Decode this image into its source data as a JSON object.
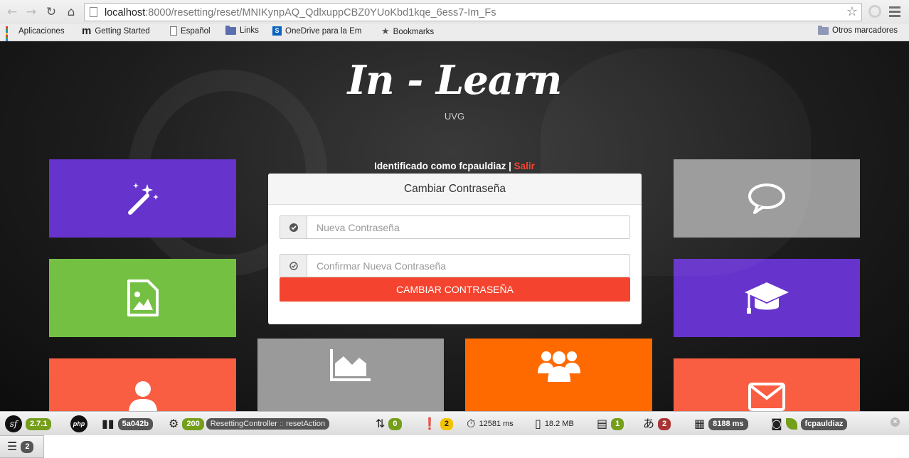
{
  "browser": {
    "url_host": "localhost",
    "url_rest": ":8000/resetting/reset/MNIKynpAQ_QdlxuppCBZ0YUoKbd1kqe_6ess7-Im_Fs",
    "bookmarks": [
      "Aplicaciones",
      "Getting Started",
      "Español",
      "Links",
      "OneDrive para la Em",
      "Bookmarks"
    ],
    "other_bookmarks": "Otros marcadores"
  },
  "site": {
    "title": "In - Learn",
    "subtitle": "UVG",
    "identified_prefix": "Identificado como fcpauldiaz",
    "separator": "|",
    "logout": "Salir"
  },
  "form": {
    "heading": "Cambiar Contraseña",
    "new_password_placeholder": "Nueva Contraseña",
    "confirm_password_placeholder": "Confirmar Nueva Contraseña",
    "submit_label": "CAMBIAR CONTRASEÑA"
  },
  "tiles": {
    "colors": {
      "purple": "#6633cc",
      "green": "#74c043",
      "grey": "#9a9a9a",
      "coral": "#fa5e42",
      "orange": "#ff6a00"
    },
    "icons": [
      "magic-wand-icon",
      "image-file-icon",
      "chat-bubble-icon",
      "graduation-cap-icon",
      "user-icon",
      "area-chart-icon",
      "group-icon",
      "envelope-icon"
    ]
  },
  "debug_toolbar": {
    "symfony_version": "2.7.1",
    "php_label": "php",
    "token": "5a042b",
    "status": "200",
    "controller": "ResettingController",
    "controller_sep": "::",
    "action": "resetAction",
    "ajax_count": "0",
    "log_count": "2",
    "time": "12581 ms",
    "memory": "18.2 MB",
    "forms_count": "1",
    "translation_count": "2",
    "render_time": "8188 ms",
    "user": "fcpauldiaz",
    "db_count": "2",
    "close": "×"
  }
}
